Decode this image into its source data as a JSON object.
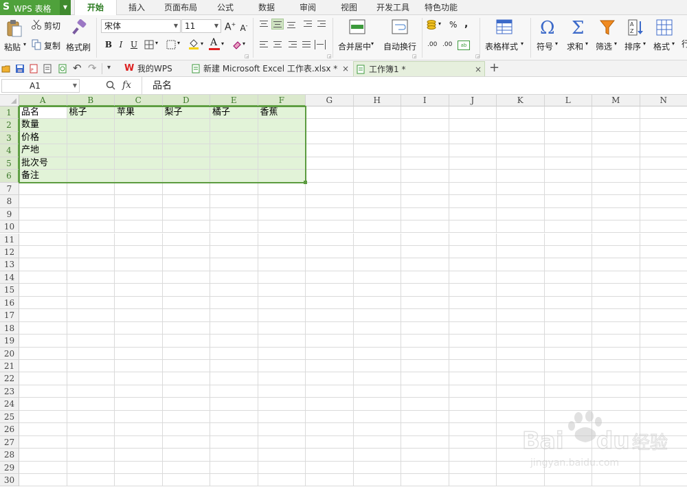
{
  "app": {
    "logo": "S",
    "name": "WPS 表格"
  },
  "menu_tabs": [
    "开始",
    "插入",
    "页面布局",
    "公式",
    "数据",
    "审阅",
    "视图",
    "开发工具",
    "特色功能"
  ],
  "ribbon": {
    "paste": "粘贴",
    "cut": "剪切",
    "copy": "复制",
    "format_painter": "格式刷",
    "font_name": "宋体",
    "font_size": "11",
    "bold": "B",
    "italic": "I",
    "underline": "U",
    "merge_center": "合并居中",
    "wrap_text": "自动换行",
    "table_style": "表格样式",
    "symbol": "符号",
    "sum": "求和",
    "filter": "筛选",
    "sort": "排序",
    "format": "格式",
    "percent": "%",
    "comma": ",",
    "dec_inc": ".00",
    "dec_dec": ".00"
  },
  "doc_tabs": [
    {
      "label": "我的WPS"
    },
    {
      "label": "新建 Microsoft Excel 工作表.xlsx *"
    },
    {
      "label": "工作簿1 *"
    }
  ],
  "formula_bar": {
    "cell_ref": "A1",
    "fx": "fx",
    "content": "品名"
  },
  "sheet": {
    "columns": [
      "A",
      "B",
      "C",
      "D",
      "E",
      "F",
      "G",
      "H",
      "I",
      "J",
      "K",
      "L",
      "M",
      "N"
    ],
    "row_count": 30,
    "cells": {
      "A1": "品名",
      "B1": "桃子",
      "C1": "苹果",
      "D1": "梨子",
      "E1": "橘子",
      "F1": "香蕉",
      "A2": "数量",
      "A3": "价格",
      "A4": "产地",
      "A5": "批次号",
      "A6": "备注"
    },
    "selection": "A1:F6",
    "active_cell": "A1"
  },
  "colors": {
    "accent": "#4fa13b",
    "selection_fill": "#e2f3d8",
    "selection_border": "#5b9b3f"
  }
}
